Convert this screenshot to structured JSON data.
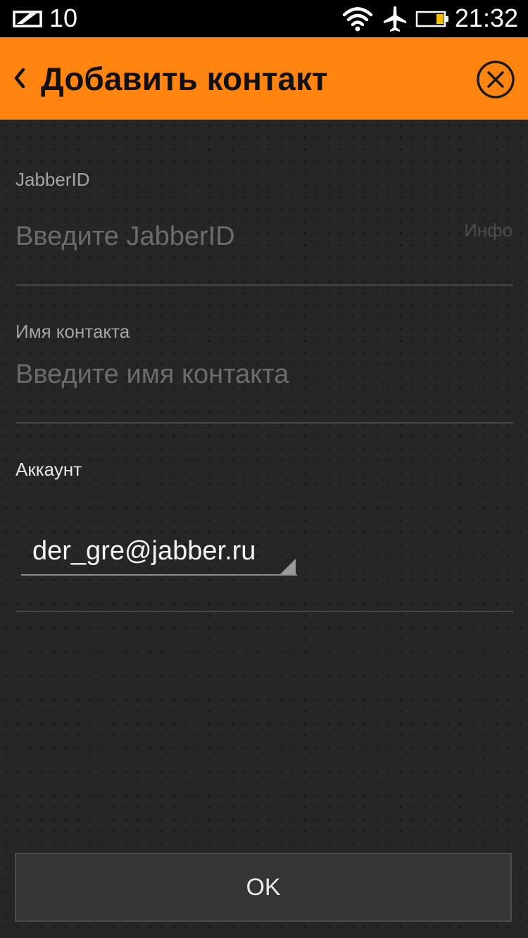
{
  "status_bar": {
    "notification_count": "10",
    "time": "21:32",
    "icons": [
      "notification-icon",
      "wifi-icon",
      "airplane-icon",
      "battery-icon"
    ]
  },
  "action_bar": {
    "title": "Добавить контакт",
    "back_icon": "chevron-left-icon",
    "close_icon": "close-circle-icon",
    "color": "#ff8510"
  },
  "form": {
    "jabber_id": {
      "label": "JabberID",
      "placeholder": "Введите JabberID",
      "value": "",
      "hint": "Инфо"
    },
    "contact_name": {
      "label": "Имя контакта",
      "placeholder": "Введите имя контакта",
      "value": ""
    },
    "account": {
      "label": "Аккаунт",
      "selected": "der_gre@jabber.ru"
    }
  },
  "ok_button": {
    "label": "OK"
  }
}
